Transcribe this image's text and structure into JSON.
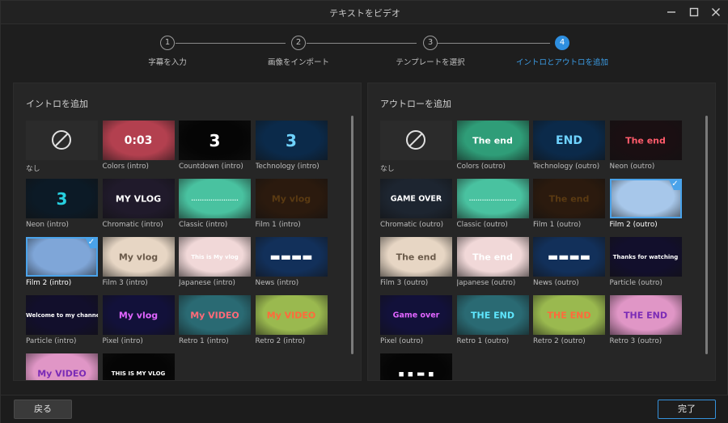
{
  "window": {
    "title": "テキストをビデオ"
  },
  "steps": [
    {
      "num": "1",
      "label": "字幕を入力"
    },
    {
      "num": "2",
      "label": "画像をインポート"
    },
    {
      "num": "3",
      "label": "テンプレートを選択"
    },
    {
      "num": "4",
      "label": "イントロとアウトロを追加"
    }
  ],
  "active_step": 4,
  "intro": {
    "title": "イントロを追加",
    "items": [
      {
        "label": "なし",
        "icon": "none-icon",
        "bg": "#2b2b2b",
        "fg": "#e0e0e0",
        "text": ""
      },
      {
        "label": "Colors (intro)",
        "bg": "#b3404f",
        "fg": "#ffffff",
        "text": "0:03"
      },
      {
        "label": "Countdown (intro)",
        "bg": "#050505",
        "fg": "#ffffff",
        "text": "3"
      },
      {
        "label": "Technology (intro)",
        "bg": "#0b2a4a",
        "fg": "#6fd3ff",
        "text": "3"
      },
      {
        "label": "Neon (intro)",
        "bg": "#0c1a26",
        "fg": "#27d0e0",
        "text": "3"
      },
      {
        "label": "Chromatic (intro)",
        "bg": "#201a2b",
        "fg": "#ffffff",
        "text": "MY VLOG"
      },
      {
        "label": "Classic (intro)",
        "bg": "#49c2a0",
        "fg": "#e8fff6",
        "text": "......................"
      },
      {
        "label": "Film 1 (intro)",
        "bg": "#2b1a0e",
        "fg": "#5a3a12",
        "text": "My vlog"
      },
      {
        "label": "Film 2 (intro)",
        "bg": "#7fa6d8",
        "fg": "#ffffff",
        "text": "",
        "selected": true
      },
      {
        "label": "Film 3 (intro)",
        "bg": "#e7d6c4",
        "fg": "#6a5a4a",
        "text": "My vlog"
      },
      {
        "label": "Japanese (intro)",
        "bg": "#f1d8d8",
        "fg": "#ffffff",
        "text": "This is My vlog"
      },
      {
        "label": "News (intro)",
        "bg": "#12305a",
        "fg": "#ffffff",
        "text": "▬▬▬▬"
      },
      {
        "label": "Particle (intro)",
        "bg": "#120f2c",
        "fg": "#ffffff",
        "text": "Welcome to my channel"
      },
      {
        "label": "Pixel (intro)",
        "bg": "#12113a",
        "fg": "#e065ff",
        "text": "My vlog"
      },
      {
        "label": "Retro 1 (intro)",
        "bg": "#2a6a73",
        "fg": "#ff6a78",
        "text": "My VIDEO"
      },
      {
        "label": "Retro 2 (intro)",
        "bg": "#9ab94f",
        "fg": "#ff6a3b",
        "text": "My VIDEO"
      },
      {
        "label": "",
        "bg": "#e096c6",
        "fg": "#7a2bb6",
        "text": "My VIDEO"
      },
      {
        "label": "",
        "bg": "#050505",
        "fg": "#ffffff",
        "text": "THIS IS MY VLOG"
      }
    ]
  },
  "outro": {
    "title": "アウトローを追加",
    "items": [
      {
        "label": "なし",
        "icon": "none-icon",
        "bg": "#2b2b2b",
        "fg": "#e0e0e0",
        "text": ""
      },
      {
        "label": "Colors (outro)",
        "bg": "#2f9d78",
        "fg": "#ffffff",
        "text": "The end"
      },
      {
        "label": "Technology (outro)",
        "bg": "#0b2a4a",
        "fg": "#6fd3ff",
        "text": "END"
      },
      {
        "label": "Neon (outro)",
        "bg": "#1a0f12",
        "fg": "#ff5b6b",
        "text": "The end"
      },
      {
        "label": "Chromatic (outro)",
        "bg": "#1d2530",
        "fg": "#ffffff",
        "text": "GAME OVER"
      },
      {
        "label": "Classic (outro)",
        "bg": "#49c2a0",
        "fg": "#e8fff6",
        "text": "......................"
      },
      {
        "label": "Film 1 (outro)",
        "bg": "#2b1a0e",
        "fg": "#5a3a12",
        "text": "The end"
      },
      {
        "label": "Film 2 (outro)",
        "bg": "#a7c7ea",
        "fg": "#ffffff",
        "text": "",
        "selected": true
      },
      {
        "label": "Film 3 (outro)",
        "bg": "#e7d6c4",
        "fg": "#6a5a4a",
        "text": "The end"
      },
      {
        "label": "Japanese (outro)",
        "bg": "#f1d8d8",
        "fg": "#ffffff",
        "text": "The end"
      },
      {
        "label": "News (outro)",
        "bg": "#12305a",
        "fg": "#ffffff",
        "text": "▬▬▬▬"
      },
      {
        "label": "Particle (outro)",
        "bg": "#120f2c",
        "fg": "#ffffff",
        "text": "Thanks for watching"
      },
      {
        "label": "Pixel (outro)",
        "bg": "#12113a",
        "fg": "#e065ff",
        "text": "Game over"
      },
      {
        "label": "Retro 1 (outro)",
        "bg": "#2a6a73",
        "fg": "#5fe7ff",
        "text": "THE END"
      },
      {
        "label": "Retro 2 (outro)",
        "bg": "#9ab94f",
        "fg": "#ff6a3b",
        "text": "THE END"
      },
      {
        "label": "Retro 3 (outro)",
        "bg": "#e096c6",
        "fg": "#7a2bb6",
        "text": "THE END"
      },
      {
        "label": "",
        "bg": "#050505",
        "fg": "#ffffff",
        "text": "▪ ▪ ▬ ▪"
      }
    ]
  },
  "footer": {
    "back_label": "戻る",
    "done_label": "完了"
  },
  "colors": {
    "accent": "#2e8fe0",
    "selected_border": "#4aa3ea"
  }
}
